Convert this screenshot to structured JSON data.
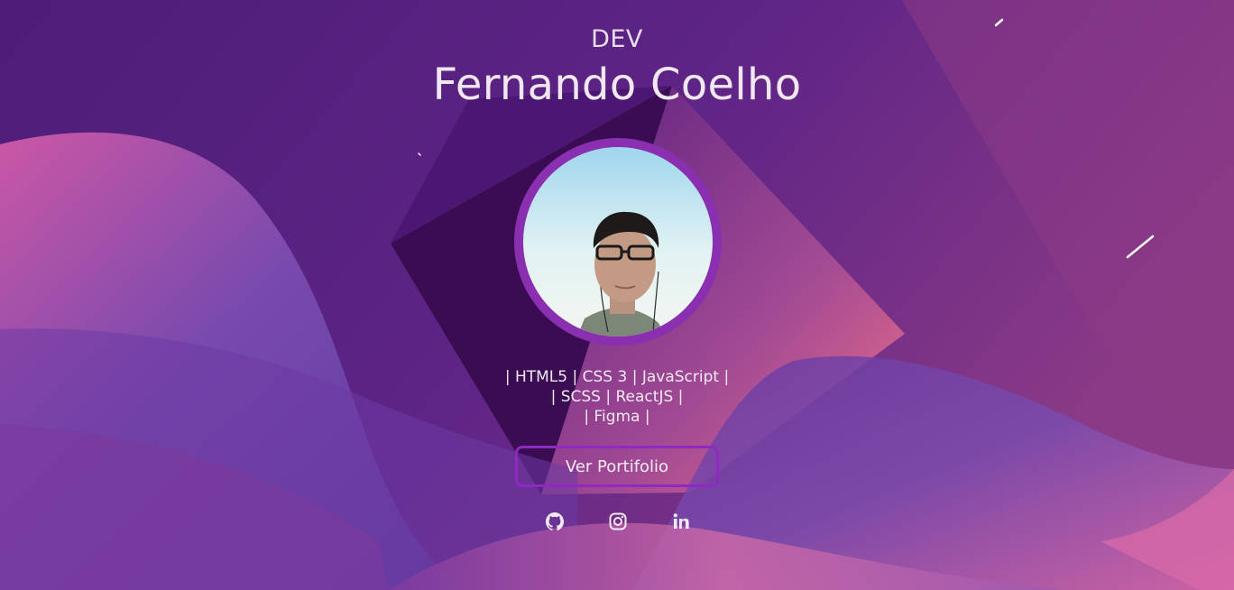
{
  "hero": {
    "eyebrow": "DEV",
    "name": "Fernando Coelho"
  },
  "avatar": {
    "alt": "Fernando Coelho"
  },
  "skills": {
    "lines": [
      "| HTML5 | CSS 3 | JavaScript |",
      "| SCSS | ReactJS |",
      "| Figma |"
    ]
  },
  "cta": {
    "label": "Ver Portifolio"
  },
  "social": {
    "items": [
      {
        "icon": "github-icon"
      },
      {
        "icon": "instagram-icon"
      },
      {
        "icon": "linkedin-icon"
      }
    ]
  },
  "colors": {
    "background": "#5b2182",
    "accent": "#9128c2",
    "text": "#f1e7f0"
  }
}
